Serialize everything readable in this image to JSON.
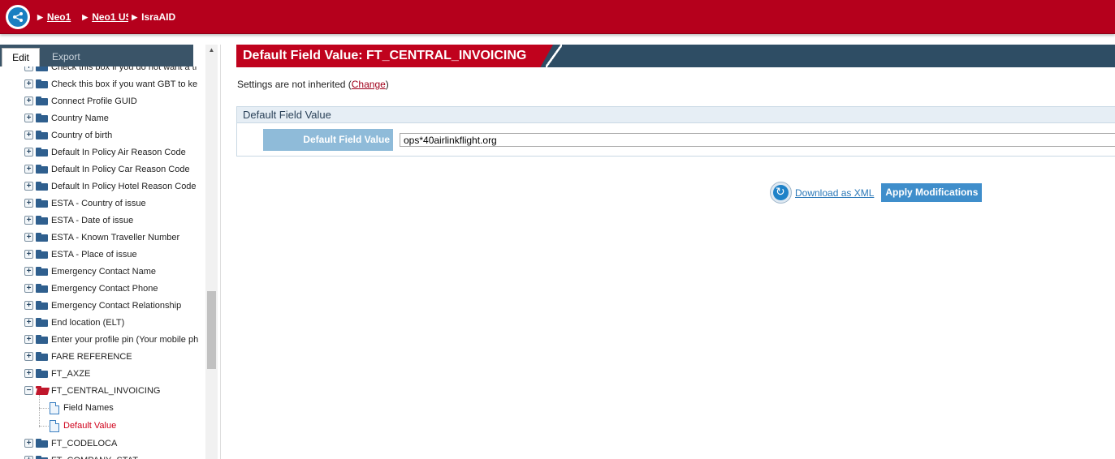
{
  "breadcrumb": {
    "items": [
      {
        "label": "Neo1",
        "link": true
      },
      {
        "label": "Neo1 US",
        "link": true
      },
      {
        "label": "IsraAID",
        "link": false
      }
    ]
  },
  "left_panel": {
    "tabs": [
      {
        "label": "Edit",
        "active": true
      },
      {
        "label": "Export",
        "active": false
      }
    ],
    "tree": {
      "items": [
        {
          "label": "Check this box if you do not want a ti",
          "type": "folder"
        },
        {
          "label": "Check this box if you want GBT to ke",
          "type": "folder"
        },
        {
          "label": "Connect Profile GUID",
          "type": "folder"
        },
        {
          "label": "Country Name",
          "type": "folder"
        },
        {
          "label": "Country of birth",
          "type": "folder"
        },
        {
          "label": "Default In Policy Air Reason Code",
          "type": "folder"
        },
        {
          "label": "Default In Policy Car Reason Code",
          "type": "folder"
        },
        {
          "label": "Default In Policy Hotel Reason Code",
          "type": "folder"
        },
        {
          "label": "ESTA - Country of issue",
          "type": "folder"
        },
        {
          "label": "ESTA - Date of issue",
          "type": "folder"
        },
        {
          "label": "ESTA - Known Traveller Number",
          "type": "folder"
        },
        {
          "label": "ESTA - Place of issue",
          "type": "folder"
        },
        {
          "label": "Emergency Contact Name",
          "type": "folder"
        },
        {
          "label": "Emergency Contact Phone",
          "type": "folder"
        },
        {
          "label": "Emergency Contact Relationship",
          "type": "folder"
        },
        {
          "label": "End location (ELT)",
          "type": "folder"
        },
        {
          "label": "Enter your profile pin (Your mobile ph",
          "type": "folder"
        },
        {
          "label": "FARE REFERENCE",
          "type": "folder"
        },
        {
          "label": "FT_AXZE",
          "type": "folder"
        },
        {
          "label": "FT_CENTRAL_INVOICING",
          "type": "folder-open"
        },
        {
          "label": "Field Names",
          "type": "doc"
        },
        {
          "label": "Default Value",
          "type": "doc-selected"
        },
        {
          "label": "FT_CODELOCA",
          "type": "folder"
        },
        {
          "label": "FT_COMPANY_STAT",
          "type": "folder"
        }
      ]
    }
  },
  "main": {
    "title": "Default Field Value: FT_CENTRAL_INVOICING",
    "inherit_text": "Settings are not inherited (",
    "inherit_link": "Change",
    "inherit_close": ")",
    "section_title": "Default Field Value",
    "field_label": "Default Field Value",
    "field_value": "ops*40airlinkflight.org",
    "download_label": "Download as XML",
    "apply_label": "Apply Modifications"
  },
  "colors": {
    "brand_red": "#b5001c",
    "header_navy": "#2e4d64",
    "accent_blue": "#3f8ecb",
    "selected_red": "#d0021b"
  }
}
